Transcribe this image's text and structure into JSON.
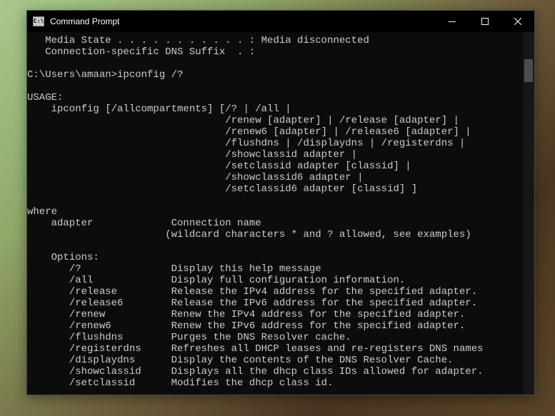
{
  "window": {
    "title": "Command Prompt"
  },
  "console": {
    "text": "   Media State . . . . . . . . . . . : Media disconnected\n   Connection-specific DNS Suffix  . :\n\nC:\\Users\\amaan>ipconfig /?\n\nUSAGE:\n    ipconfig [/allcompartments] [/? | /all |\n                                 /renew [adapter] | /release [adapter] |\n                                 /renew6 [adapter] | /release6 [adapter] |\n                                 /flushdns | /displaydns | /registerdns |\n                                 /showclassid adapter |\n                                 /setclassid adapter [classid] |\n                                 /showclassid6 adapter |\n                                 /setclassid6 adapter [classid] ]\n\nwhere\n    adapter             Connection name\n                       (wildcard characters * and ? allowed, see examples)\n\n    Options:\n       /?               Display this help message\n       /all             Display full configuration information.\n       /release         Release the IPv4 address for the specified adapter.\n       /release6        Release the IPv6 address for the specified adapter.\n       /renew           Renew the IPv4 address for the specified adapter.\n       /renew6          Renew the IPv6 address for the specified adapter.\n       /flushdns        Purges the DNS Resolver cache.\n       /registerdns     Refreshes all DHCP leases and re-registers DNS names\n       /displaydns      Display the contents of the DNS Resolver Cache.\n       /showclassid     Displays all the dhcp class IDs allowed for adapter.\n       /setclassid      Modifies the dhcp class id."
  }
}
